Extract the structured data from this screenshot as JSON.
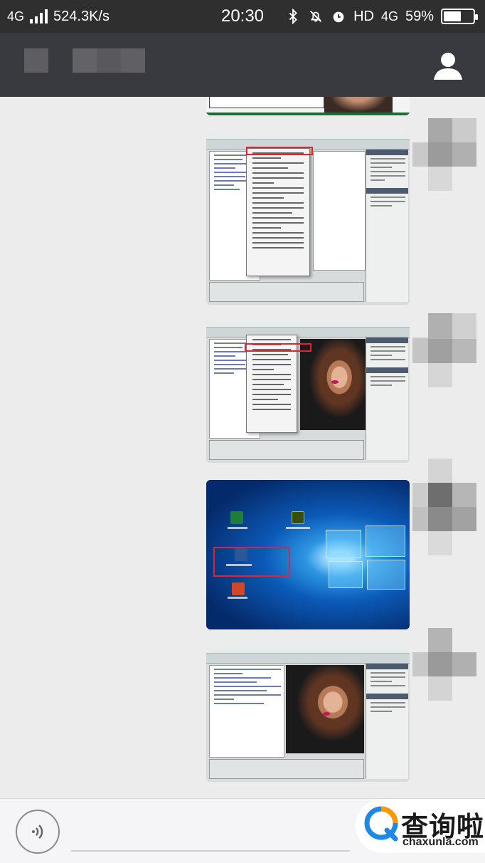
{
  "status_bar": {
    "network": "4G",
    "speed": "524.3K/s",
    "time": "20:30",
    "hd": "HD",
    "network_right": "4G",
    "battery": "59%",
    "battery_level": 0.59,
    "icons": [
      "signal-icon",
      "bluetooth-icon",
      "mute-icon",
      "alarm-icon",
      "battery-icon"
    ]
  },
  "header": {
    "contact_name_blurred": true,
    "profile_icon": "person-icon"
  },
  "chat": {
    "messages": [
      {
        "type": "image",
        "content": "excel-screenshot-partial"
      },
      {
        "type": "image",
        "content": "dreamweaver-menu-screenshot"
      },
      {
        "type": "image",
        "content": "dreamweaver-menu-photo-screenshot"
      },
      {
        "type": "image",
        "content": "windows10-desktop-screenshot"
      },
      {
        "type": "image",
        "content": "dreamweaver-photo-screenshot"
      }
    ]
  },
  "input_bar": {
    "voice_icon": "voice-icon",
    "plus_icon": "plus-icon"
  },
  "watermark": {
    "cn": "查询啦",
    "en": "chaxunla.com",
    "logo_colors": [
      "#1e88e5",
      "#ff9800"
    ]
  },
  "colors": {
    "statusbar": "#2f2f2f",
    "titlebar": "#393a3f",
    "chat_bg": "#ececec",
    "highlight": "#e0262c"
  }
}
